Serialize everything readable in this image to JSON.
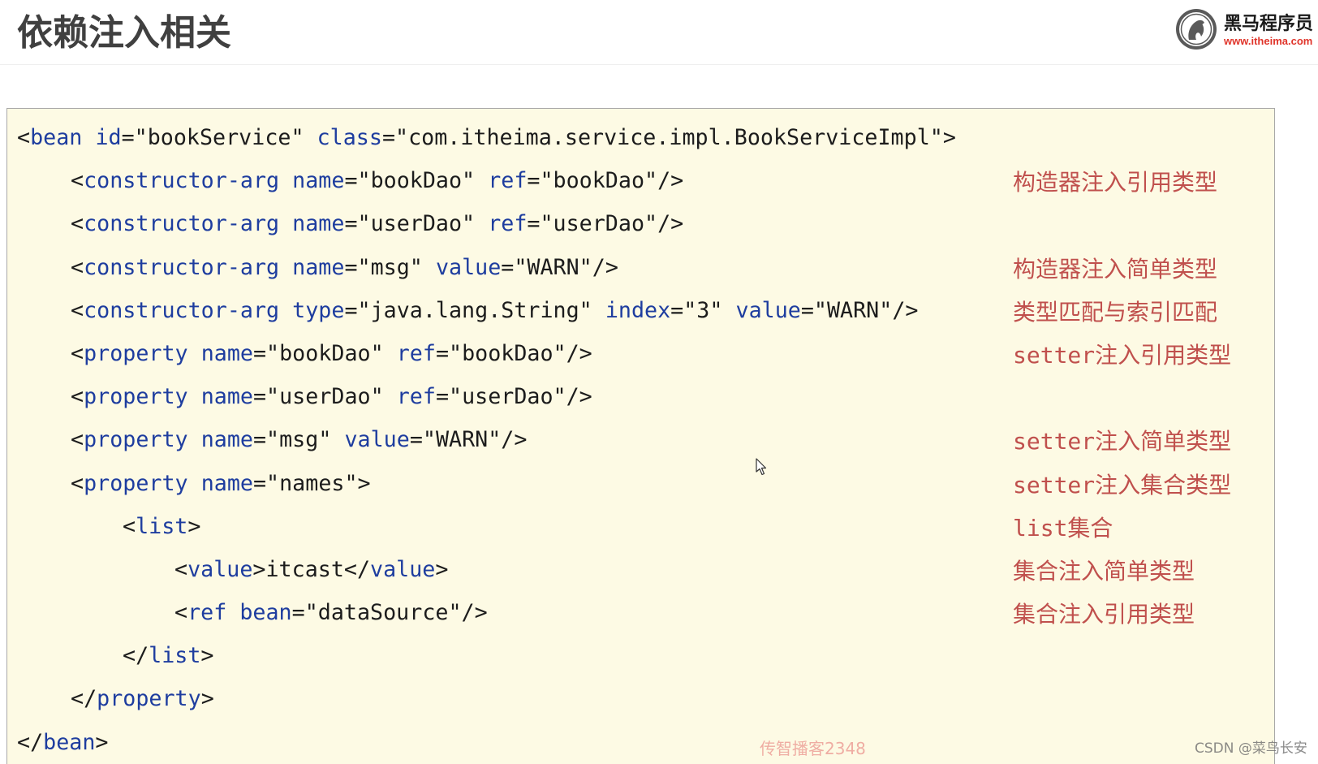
{
  "header": {
    "title": "依赖注入相关",
    "logo": {
      "icon": "horse-logo-icon",
      "name": "黑马程序员",
      "url": "www.itheima.com"
    }
  },
  "code": {
    "lines": [
      {
        "text": "<bean id=\"bookService\" class=\"com.itheima.service.impl.BookServiceImpl\">"
      },
      {
        "text": "<constructor-arg name=\"bookDao\" ref=\"bookDao\"/>",
        "note": "构造器注入引用类型"
      },
      {
        "text": "<constructor-arg name=\"userDao\" ref=\"userDao\"/>"
      },
      {
        "text": "<constructor-arg name=\"msg\" value=\"WARN\"/>",
        "note": "构造器注入简单类型"
      },
      {
        "text": "<constructor-arg type=\"java.lang.String\" index=\"3\" value=\"WARN\"/>",
        "note": "类型匹配与索引匹配"
      },
      {
        "text": "<property name=\"bookDao\" ref=\"bookDao\"/>",
        "note": "setter注入引用类型"
      },
      {
        "text": "<property name=\"userDao\" ref=\"userDao\"/>"
      },
      {
        "text": "<property name=\"msg\" value=\"WARN\"/>",
        "note": "setter注入简单类型"
      },
      {
        "text": "<property name=\"names\">",
        "note": "setter注入集合类型"
      },
      {
        "text": "<list>",
        "note": "list集合"
      },
      {
        "text": "<value>itcast</value>",
        "note": "集合注入简单类型"
      },
      {
        "text": "<ref bean=\"dataSource\"/>",
        "note": "集合注入引用类型"
      },
      {
        "text": "</list>"
      },
      {
        "text": "</property>"
      },
      {
        "text": "</bean>"
      }
    ]
  },
  "overlay": {
    "pointer_icon": "mouse-pointer-icon",
    "watermark": "传智播客2348",
    "credit": "CSDN @菜鸟长安"
  },
  "colors": {
    "code_background": "#fdfae4",
    "code_keyword": "#1e3d9f",
    "code_text": "#1c1c1c",
    "annotation": "#c0504d",
    "title": "#404040",
    "brand_red": "#e0352b"
  }
}
